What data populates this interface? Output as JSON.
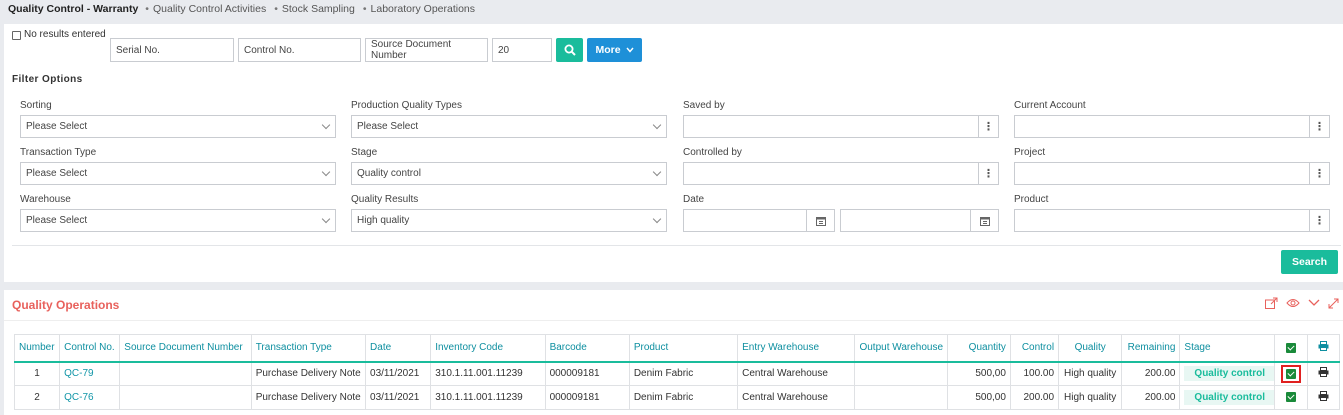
{
  "breadcrumb": {
    "title": "Quality Control - Warranty",
    "items": [
      "Quality Control Activities",
      "Stock Sampling",
      "Laboratory Operations"
    ]
  },
  "search_bar": {
    "no_results_label": "No results entered",
    "serial_placeholder": "Serial No.",
    "control_placeholder": "Control No.",
    "source_doc_placeholder": "Source Document Number",
    "count_value": "20",
    "more_label": "More"
  },
  "filters": {
    "title": "Filter Options",
    "sorting": {
      "label": "Sorting",
      "value": "Please Select"
    },
    "production_quality_types": {
      "label": "Production Quality Types",
      "value": "Please Select"
    },
    "saved_by": {
      "label": "Saved by",
      "value": ""
    },
    "current_account": {
      "label": "Current Account",
      "value": ""
    },
    "transaction_type": {
      "label": "Transaction Type",
      "value": "Please Select"
    },
    "stage": {
      "label": "Stage",
      "value": "Quality control"
    },
    "controlled_by": {
      "label": "Controlled by",
      "value": ""
    },
    "project": {
      "label": "Project",
      "value": ""
    },
    "warehouse": {
      "label": "Warehouse",
      "value": "Please Select"
    },
    "quality_results": {
      "label": "Quality Results",
      "value": "High quality"
    },
    "date": {
      "label": "Date",
      "from": "",
      "to": ""
    },
    "product": {
      "label": "Product",
      "value": ""
    },
    "search_label": "Search"
  },
  "operations": {
    "title": "Quality Operations",
    "columns": [
      "Number",
      "Control No.",
      "Source Document Number",
      "Transaction Type",
      "Date",
      "Inventory Code",
      "Barcode",
      "Product",
      "Entry Warehouse",
      "Output Warehouse",
      "Quantity",
      "Control",
      "Quality",
      "Remaining",
      "Stage"
    ],
    "rows": [
      {
        "number": "1",
        "control_no": "QC-79",
        "source_doc": "",
        "transaction_type": "Purchase Delivery Note",
        "date": "03/11/2021",
        "inventory_code": "310.1.11.001.11239",
        "barcode": "000009181",
        "product": "Denim Fabric",
        "entry_warehouse": "Central Warehouse",
        "output_warehouse": "",
        "quantity": "500,00",
        "control": "100.00",
        "quality": "High quality",
        "remaining": "200.00",
        "stage": "Quality control"
      },
      {
        "number": "2",
        "control_no": "QC-76",
        "source_doc": "",
        "transaction_type": "Purchase Delivery Note",
        "date": "03/11/2021",
        "inventory_code": "310.1.11.001.11239",
        "barcode": "000009181",
        "product": "Denim Fabric",
        "entry_warehouse": "Central Warehouse",
        "output_warehouse": "",
        "quantity": "500,00",
        "control": "200.00",
        "quality": "High quality",
        "remaining": "200.00",
        "stage": "Quality control"
      }
    ]
  },
  "colors": {
    "accent": "#1abc9c",
    "primary": "#1e90d8",
    "title_red": "#e8615c",
    "header_teal": "#0e8fa0"
  }
}
